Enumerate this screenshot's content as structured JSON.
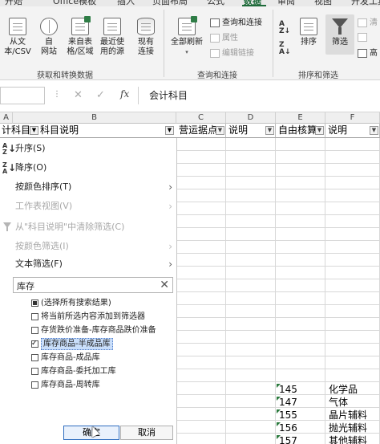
{
  "tabs": {
    "items": [
      "开始",
      "Office模板",
      "插入",
      "页面布局",
      "公式",
      "数据",
      "审阅",
      "视图",
      "开发工具"
    ],
    "active": "数据"
  },
  "ribbon": {
    "get_data_group": {
      "label": "获取和转换数据",
      "buttons": [
        "从文\n本/CSV",
        "自\n网站",
        "来自表\n格/区域",
        "最近使\n用的源",
        "现有\n连接"
      ]
    },
    "queries_group": {
      "label": "查询和连接",
      "refresh_all": "全部刷新",
      "queries_connections": "查询和连接",
      "properties": "属性",
      "edit_links": "编辑链接"
    },
    "sort_filter_group": {
      "label": "排序和筛选",
      "sort": "排序",
      "filter": "筛选",
      "clear": "清",
      "reapply": "高"
    }
  },
  "formula_bar": {
    "name_box": "",
    "cancel_icon": "✕",
    "enter_icon": "✓",
    "fx": "fx",
    "content": "会计科目"
  },
  "columns": [
    "A",
    "B",
    "C",
    "D",
    "E",
    "F"
  ],
  "left_headers": {
    "a": "计科目",
    "b": "科目说明"
  },
  "grid_headers": [
    "营运据点",
    "说明",
    "自由核算",
    "说明"
  ],
  "grid_rows": [
    {
      "e": "145",
      "f": "化学品"
    },
    {
      "e": "147",
      "f": "气体"
    },
    {
      "e": "155",
      "f": "晶片辅料"
    },
    {
      "e": "156",
      "f": "抛光辅料"
    },
    {
      "e": "157",
      "f": "其他辅料"
    }
  ],
  "filter_menu": {
    "sort_asc": "升序(S)",
    "sort_desc": "降序(O)",
    "sort_by_color": "按颜色排序(T)",
    "sheet_view": "工作表视图(V)",
    "clear_filter": "从\"科目说明\"中清除筛选(C)",
    "filter_by_color": "按颜色筛选(I)",
    "text_filters": "文本筛选(F)",
    "search_value": "库存",
    "search_clear": "✕",
    "items": [
      {
        "label": "(选择所有搜索结果)",
        "state": "partial"
      },
      {
        "label": "将当前所选内容添加到筛选器",
        "state": "unchecked"
      },
      {
        "label": "存货跌价准备-库存商品跌价准备",
        "state": "unchecked"
      },
      {
        "label": "库存商品-半成品库",
        "state": "checked"
      },
      {
        "label": "库存商品-成品库",
        "state": "unchecked"
      },
      {
        "label": "库存商品-委托加工库",
        "state": "unchecked"
      },
      {
        "label": "库存商品-周转库",
        "state": "unchecked"
      }
    ],
    "ok": "确定",
    "cancel": "取消"
  },
  "colors": {
    "accent_green": "#1e6b3a",
    "selection_blue": "#c9defa",
    "ok_border": "#2f6dbf"
  }
}
